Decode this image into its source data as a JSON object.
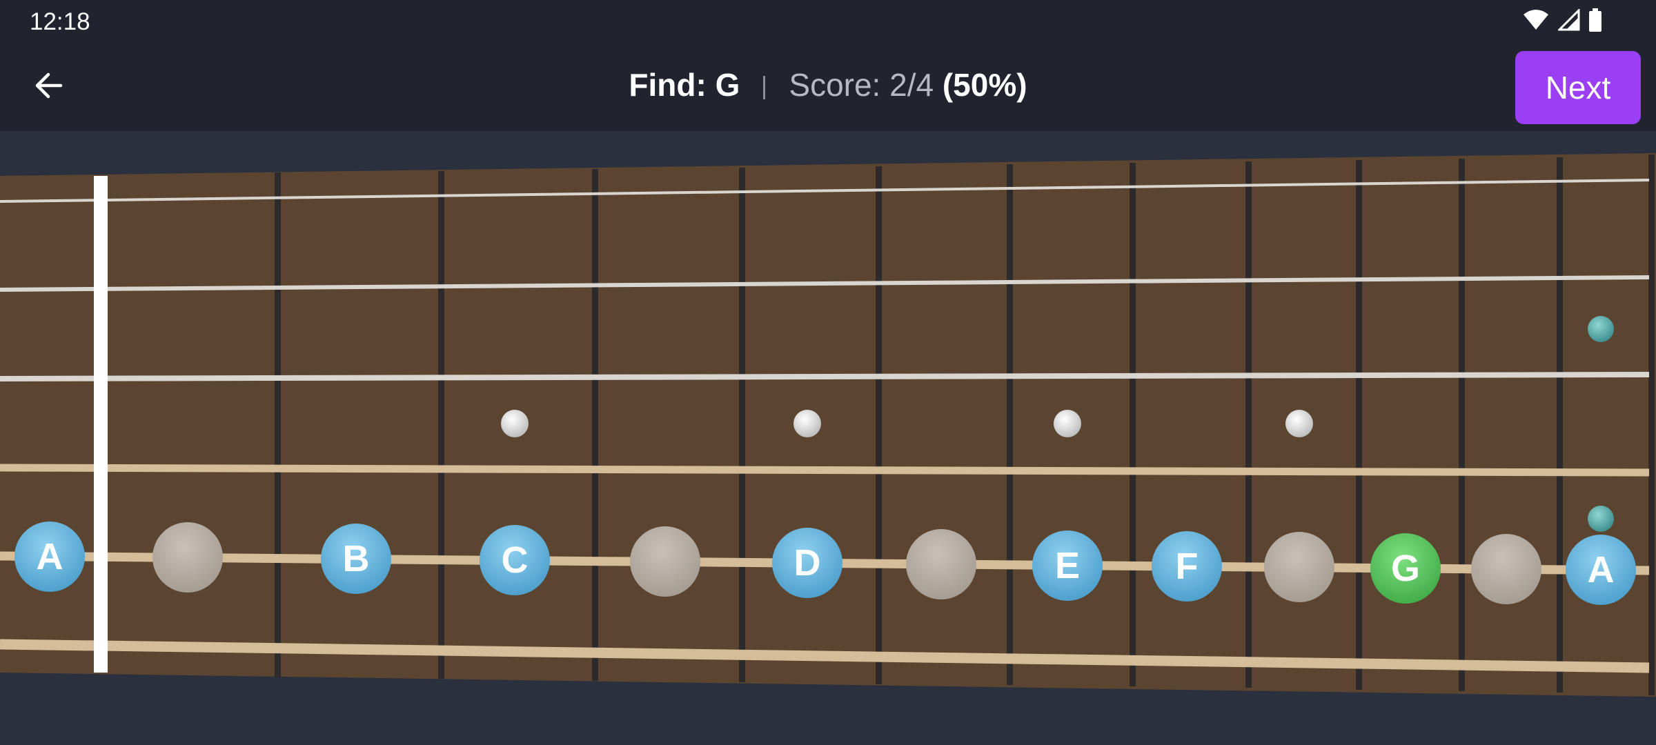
{
  "status": {
    "time": "12:18"
  },
  "header": {
    "find_label": "Find: G",
    "score_label": "Score: 2/4",
    "score_percent": "(50%)",
    "next_label": "Next"
  },
  "icons": {
    "back": "arrow-left-icon",
    "wifi": "wifi-icon",
    "signal": "signal-icon",
    "battery": "battery-icon"
  },
  "colors": {
    "fretboard": "#5b4530",
    "note_blue": "#6cb6de",
    "note_green": "#56c65a",
    "note_empty": "#b5aca3",
    "accent": "#9b3ff5"
  },
  "notes": [
    "A",
    "",
    "B",
    "C",
    "",
    "D",
    "",
    "E",
    "F",
    "",
    "G",
    "",
    "A"
  ],
  "highlight": "G"
}
